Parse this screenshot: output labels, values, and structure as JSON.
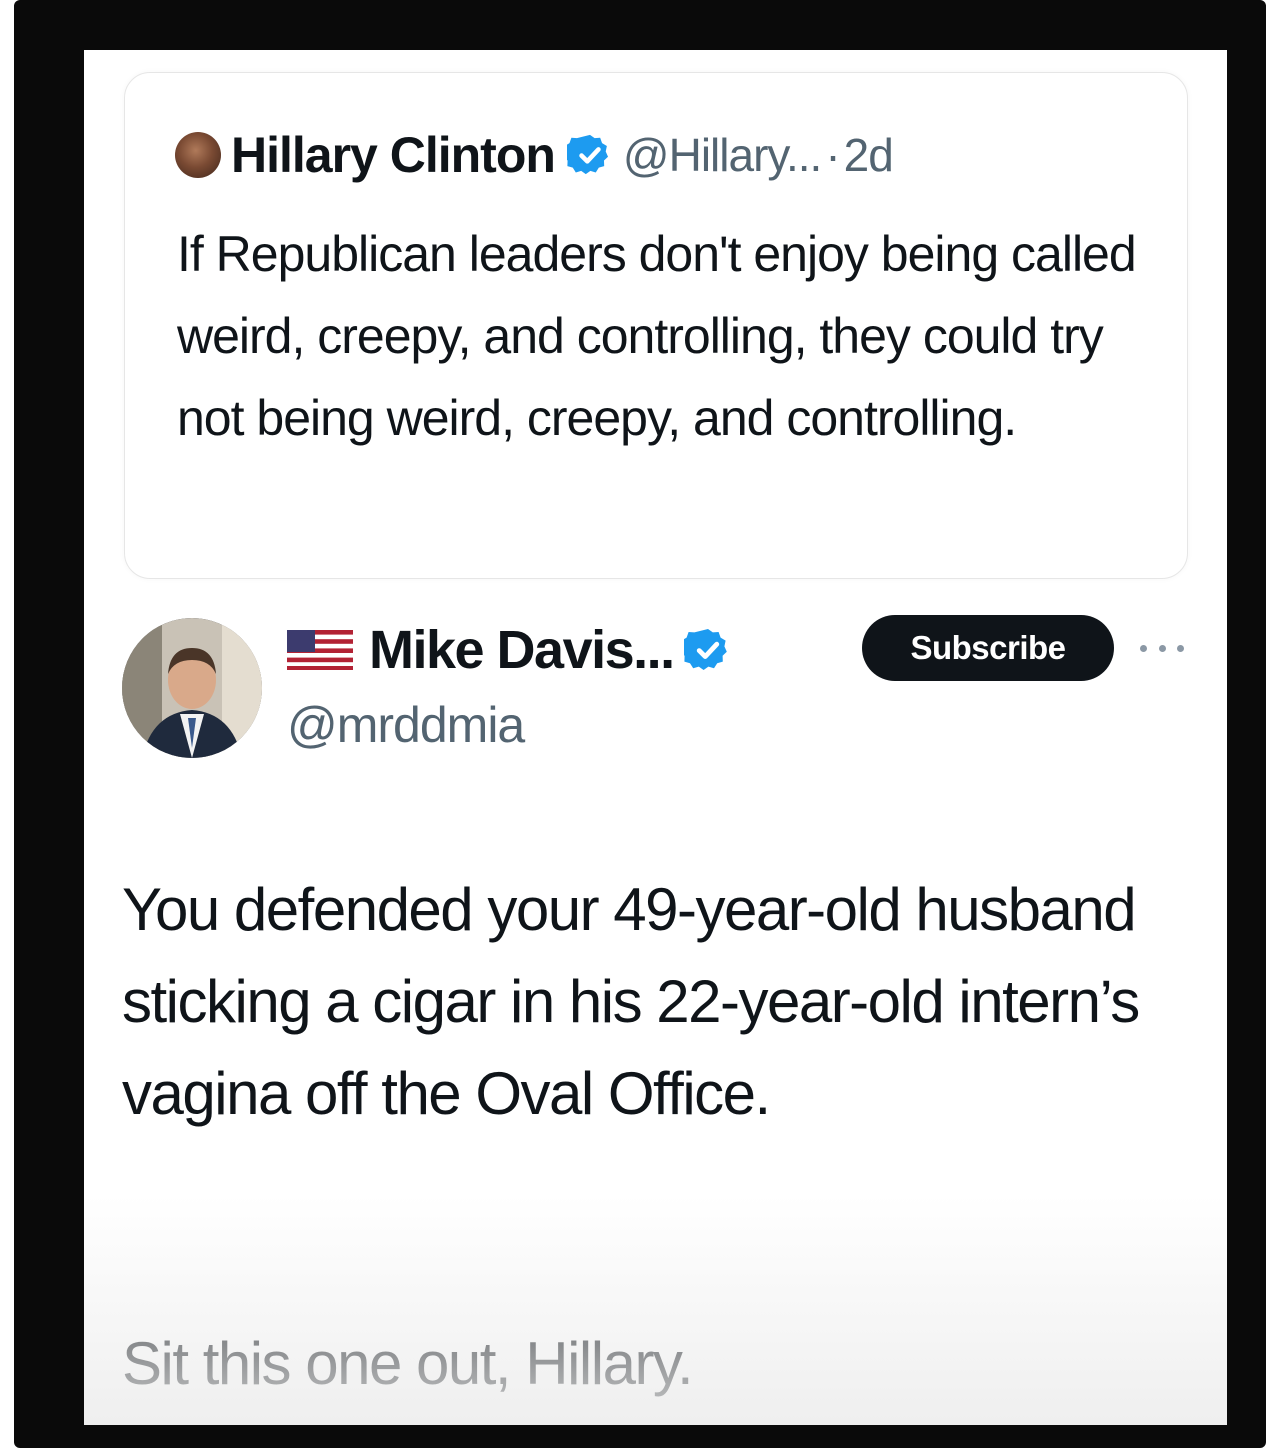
{
  "quoted_tweet": {
    "author_name": "Hillary Clinton",
    "author_handle": "@Hillary...",
    "separator": "·",
    "timestamp": "2d",
    "text": "If Republican leaders don't enjoy being called weird, creepy, and controlling, they could try not being weird, creepy, and controlling."
  },
  "reply_tweet": {
    "author_name": "Mike Davis...",
    "author_handle": "@mrddmia",
    "subscribe_label": "Subscribe",
    "more_icon": "more-horizontal-icon",
    "text": "You defended your 49-year-old husband sticking a cigar in his 22-year-old intern’s vagina off the Oval Office.",
    "closing": "Sit this one out, Hillary."
  },
  "colors": {
    "verified_blue": "#1d9bf0",
    "text_primary": "#0f1419",
    "text_secondary": "#536471",
    "subscribe_bg": "#0f1419",
    "frame": "#0a0a0a"
  }
}
